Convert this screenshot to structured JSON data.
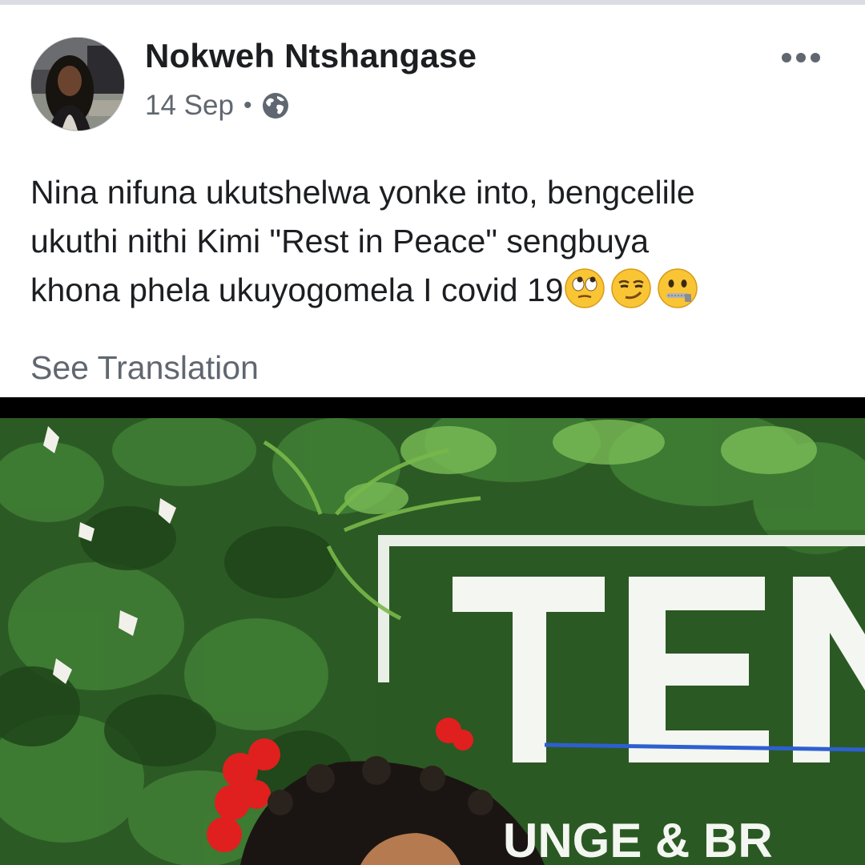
{
  "post": {
    "author": "Nokweh Ntshangase",
    "date": "14 Sep",
    "separator": "•",
    "privacy_icon": "globe-icon",
    "more_icon": "more-options-icon",
    "text_lines": [
      "Nina nifuna ukutshelwa yonke into, bengcelile",
      "ukuthi nithi Kimi \"Rest in Peace\" sengbuya",
      "khona phela ukuyogomela I covid 19"
    ],
    "emojis": [
      "face-with-rolling-eyes-emoji",
      "smirking-face-emoji",
      "zipper-mouth-face-emoji"
    ],
    "see_translation": "See Translation"
  },
  "photo": {
    "sign_text_large": "TEN",
    "sign_text_small": "UNGE & BR"
  },
  "colors": {
    "text_primary": "#1c1e21",
    "text_secondary": "#606770",
    "foliage": "#2f6a2a",
    "flowers_red": "#e0201e"
  }
}
